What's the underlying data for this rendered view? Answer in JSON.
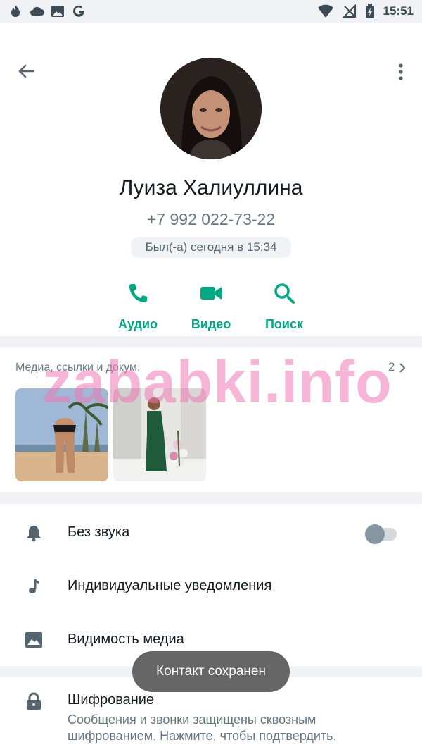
{
  "status_bar": {
    "time": "15:51",
    "left_icons": [
      "tinder-flame-icon",
      "cloud-icon",
      "image-icon",
      "google-icon"
    ],
    "right_icons": [
      "wifi-icon",
      "no-signal-icon",
      "battery-charging-icon"
    ]
  },
  "contact": {
    "name": "Луиза Халиуллина",
    "phone": "+7 992 022-73-22",
    "last_seen": "Был(-а) сегодня в 15:34"
  },
  "actions": [
    {
      "label": "Аудио",
      "icon": "phone-icon"
    },
    {
      "label": "Видео",
      "icon": "video-icon"
    },
    {
      "label": "Поиск",
      "icon": "search-icon"
    }
  ],
  "media": {
    "title": "Медиа, ссылки и докум.",
    "count": "2"
  },
  "settings": {
    "mute_label": "Без звука",
    "mute_enabled": false,
    "custom_notifications_label": "Индивидуальные уведомления",
    "media_visibility_label": "Видимость медиа"
  },
  "encryption": {
    "title": "Шифрование",
    "description": "Сообщения и звонки защищены сквозным шифрованием. Нажмите, чтобы подтвердить."
  },
  "toast": "Контакт сохранен",
  "watermark": "zababki.info",
  "colors": {
    "accent": "#00a884",
    "secondary_text": "#667781",
    "background": "#f0f2f5",
    "watermark": "#ee78b4"
  }
}
